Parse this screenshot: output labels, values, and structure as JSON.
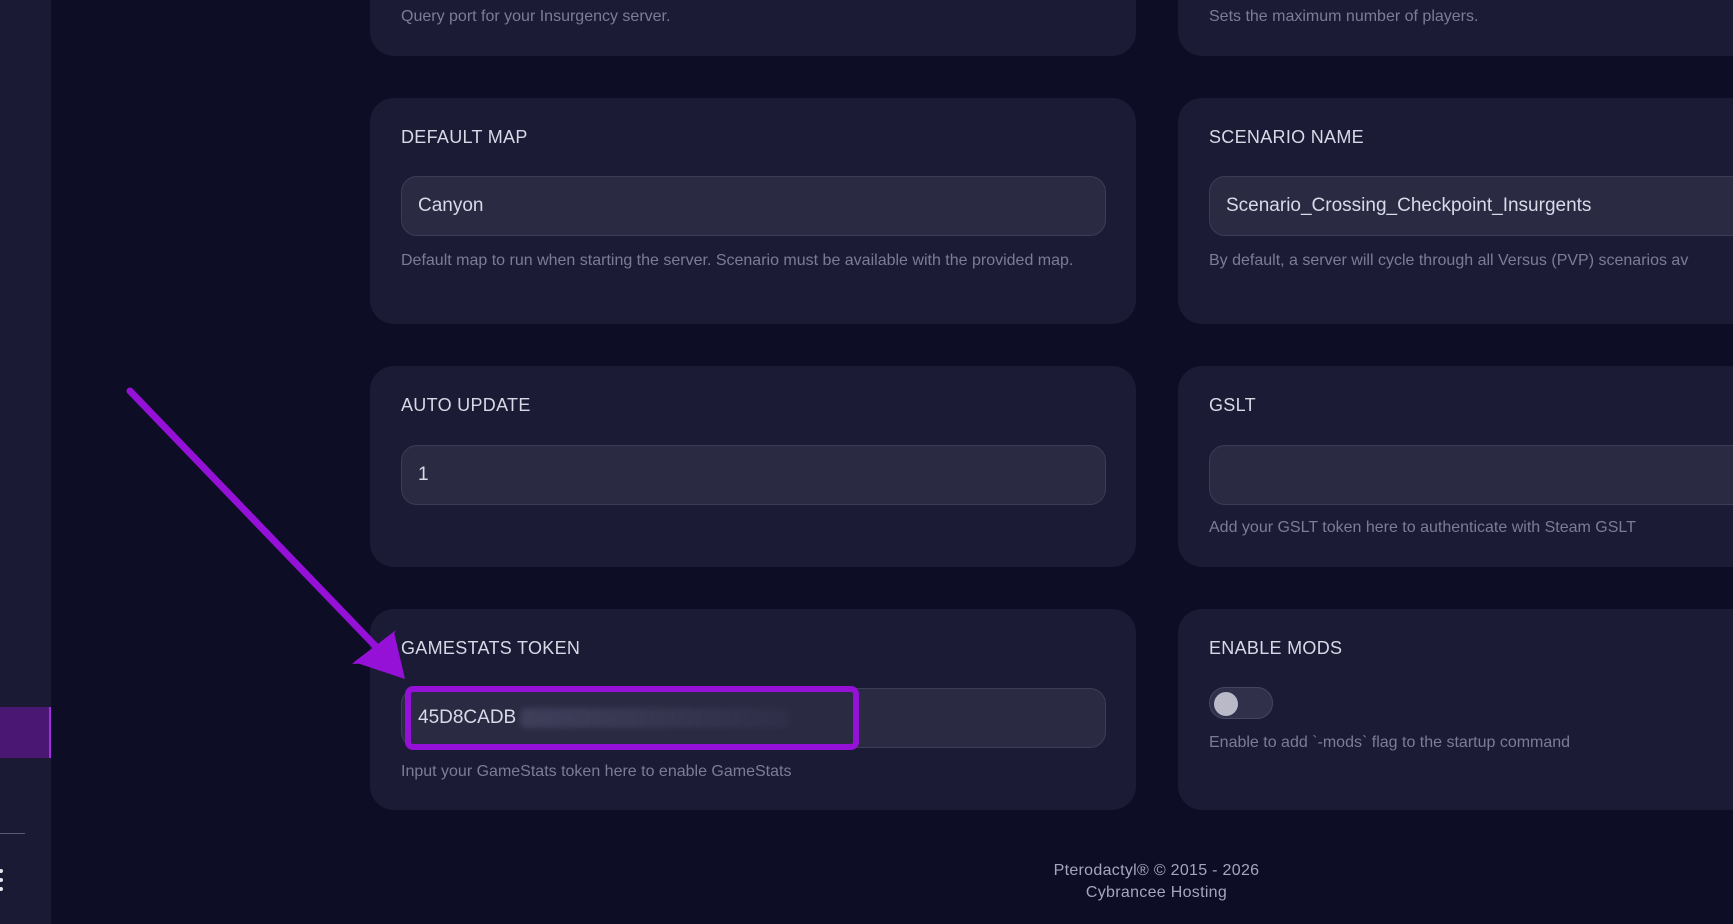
{
  "cards": {
    "query_port": {
      "description": "Query port for your Insurgency server."
    },
    "max_players": {
      "description": "Sets the maximum number of players."
    },
    "default_map": {
      "title": "DEFAULT MAP",
      "value": "Canyon",
      "description": "Default map to run when starting the server. Scenario must be available with the provided map."
    },
    "scenario_name": {
      "title": "SCENARIO NAME",
      "value": "Scenario_Crossing_Checkpoint_Insurgents",
      "description": "By default, a server will cycle through all Versus (PVP) scenarios av"
    },
    "auto_update": {
      "title": "AUTO UPDATE",
      "value": "1"
    },
    "gslt": {
      "title": "GSLT",
      "value": "",
      "description": "Add your GSLT token here to authenticate with Steam GSLT"
    },
    "gamestats_token": {
      "title": "GAMESTATS TOKEN",
      "value": "45D8CADB",
      "description": "Input your GameStats token here to enable GameStats"
    },
    "enable_mods": {
      "title": "ENABLE MODS",
      "enabled": false,
      "description": "Enable to add `-mods` flag to the startup command"
    }
  },
  "footer": {
    "copyright": "Pterodactyl® © 2015 - 2026",
    "host": "Cybrancee Hosting"
  },
  "colors": {
    "background": "#0d0d26",
    "card": "#1c1b36",
    "input": "#2a2a43",
    "highlight": "#9611d8"
  }
}
